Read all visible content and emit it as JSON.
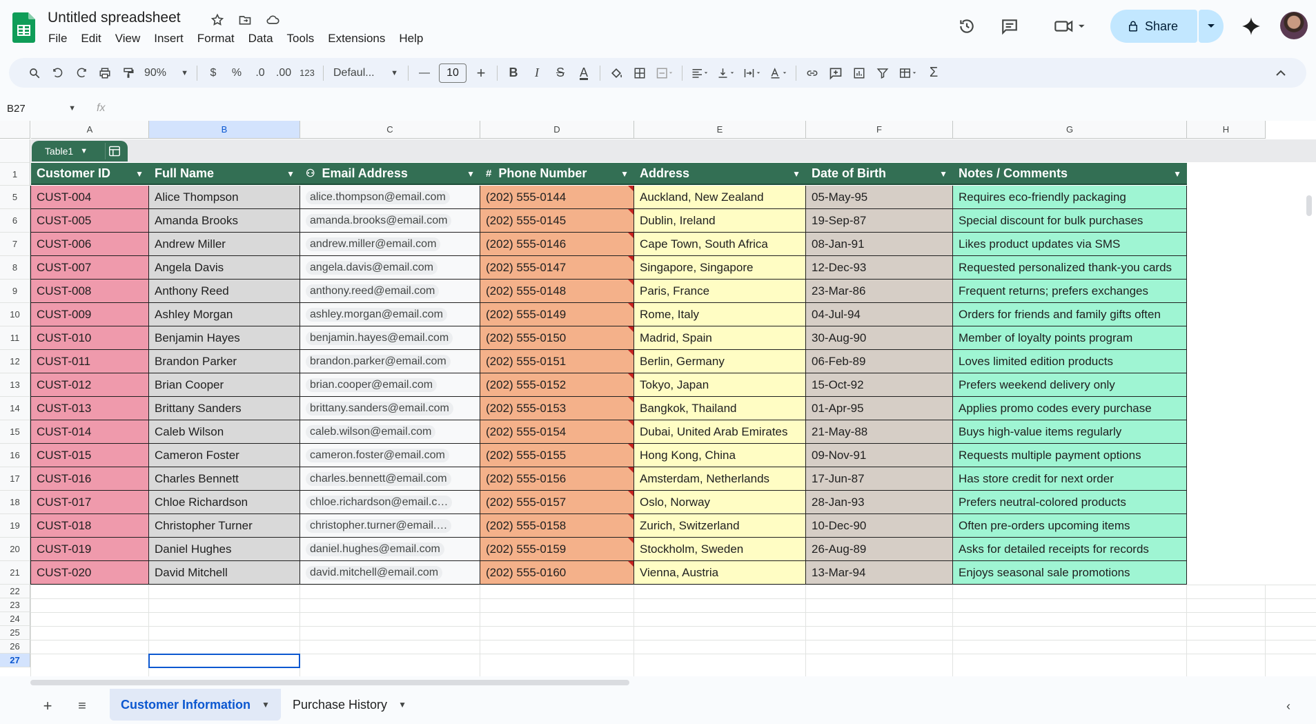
{
  "doc": {
    "title": "Untitled spreadsheet"
  },
  "menu": [
    "File",
    "Edit",
    "View",
    "Insert",
    "Format",
    "Data",
    "Tools",
    "Extensions",
    "Help"
  ],
  "share": {
    "label": "Share"
  },
  "toolbar": {
    "zoom": "90%",
    "currency": "$",
    "percent": "%",
    "dec_decrease": ".0",
    "dec_increase": ".00",
    "number_format": "123",
    "font": "Defaul...",
    "font_size": "10",
    "bold": "B",
    "italic": "I",
    "strike": "S",
    "text_color": "A"
  },
  "formula_bar": {
    "name_box": "B27",
    "fx": "fx"
  },
  "columns": [
    "A",
    "B",
    "C",
    "D",
    "E",
    "F",
    "G",
    "H"
  ],
  "table": {
    "name": "Table1",
    "headers": [
      "Customer ID",
      "Full Name",
      "Email Address",
      "Phone Number",
      "Address",
      "Date of Birth",
      "Notes / Comments"
    ],
    "rows": [
      [
        "CUST-004",
        "Alice Thompson",
        "alice.thompson@email.com",
        "(202) 555-0144",
        "Auckland, New Zealand",
        "05-May-95",
        "Requires eco-friendly packaging"
      ],
      [
        "CUST-005",
        "Amanda Brooks",
        "amanda.brooks@email.com",
        "(202) 555-0145",
        "Dublin, Ireland",
        "19-Sep-87",
        "Special discount for bulk purchases"
      ],
      [
        "CUST-006",
        "Andrew Miller",
        "andrew.miller@email.com",
        "(202) 555-0146",
        "Cape Town, South Africa",
        "08-Jan-91",
        "Likes product updates via SMS"
      ],
      [
        "CUST-007",
        "Angela Davis",
        "angela.davis@email.com",
        "(202) 555-0147",
        "Singapore, Singapore",
        "12-Dec-93",
        "Requested personalized thank-you cards"
      ],
      [
        "CUST-008",
        "Anthony Reed",
        "anthony.reed@email.com",
        "(202) 555-0148",
        "Paris, France",
        "23-Mar-86",
        "Frequent returns; prefers exchanges"
      ],
      [
        "CUST-009",
        "Ashley Morgan",
        "ashley.morgan@email.com",
        "(202) 555-0149",
        "Rome, Italy",
        "04-Jul-94",
        "Orders for friends and family gifts often"
      ],
      [
        "CUST-010",
        "Benjamin Hayes",
        "benjamin.hayes@email.com",
        "(202) 555-0150",
        "Madrid, Spain",
        "30-Aug-90",
        "Member of loyalty points program"
      ],
      [
        "CUST-011",
        "Brandon Parker",
        "brandon.parker@email.com",
        "(202) 555-0151",
        "Berlin, Germany",
        "06-Feb-89",
        "Loves limited edition products"
      ],
      [
        "CUST-012",
        "Brian Cooper",
        "brian.cooper@email.com",
        "(202) 555-0152",
        "Tokyo, Japan",
        "15-Oct-92",
        "Prefers weekend delivery only"
      ],
      [
        "CUST-013",
        "Brittany Sanders",
        "brittany.sanders@email.com",
        "(202) 555-0153",
        "Bangkok, Thailand",
        "01-Apr-95",
        "Applies promo codes every purchase"
      ],
      [
        "CUST-014",
        "Caleb Wilson",
        "caleb.wilson@email.com",
        "(202) 555-0154",
        "Dubai, United Arab Emirates",
        "21-May-88",
        "Buys high-value items regularly"
      ],
      [
        "CUST-015",
        "Cameron Foster",
        "cameron.foster@email.com",
        "(202) 555-0155",
        "Hong Kong, China",
        "09-Nov-91",
        "Requests multiple payment options"
      ],
      [
        "CUST-016",
        "Charles Bennett",
        "charles.bennett@email.com",
        "(202) 555-0156",
        "Amsterdam, Netherlands",
        "17-Jun-87",
        "Has store credit for next order"
      ],
      [
        "CUST-017",
        "Chloe Richardson",
        "chloe.richardson@email.c…",
        "(202) 555-0157",
        "Oslo, Norway",
        "28-Jan-93",
        "Prefers neutral-colored products"
      ],
      [
        "CUST-018",
        "Christopher Turner",
        "christopher.turner@email.…",
        "(202) 555-0158",
        "Zurich, Switzerland",
        "10-Dec-90",
        "Often pre-orders upcoming items"
      ],
      [
        "CUST-019",
        "Daniel Hughes",
        "daniel.hughes@email.com",
        "(202) 555-0159",
        "Stockholm, Sweden",
        "26-Aug-89",
        "Asks for detailed receipts for records"
      ],
      [
        "CUST-020",
        "David Mitchell",
        "david.mitchell@email.com",
        "(202) 555-0160",
        "Vienna, Austria",
        "13-Mar-94",
        "Enjoys seasonal sale promotions"
      ]
    ]
  },
  "row_numbers": [
    "1",
    "5",
    "6",
    "7",
    "8",
    "9",
    "10",
    "11",
    "12",
    "13",
    "14",
    "15",
    "16",
    "17",
    "18",
    "19",
    "20",
    "21",
    "22",
    "23",
    "24",
    "25",
    "26",
    "27"
  ],
  "sheets": [
    {
      "label": "Customer Information",
      "active": true
    },
    {
      "label": "Purchase History",
      "active": false
    }
  ]
}
